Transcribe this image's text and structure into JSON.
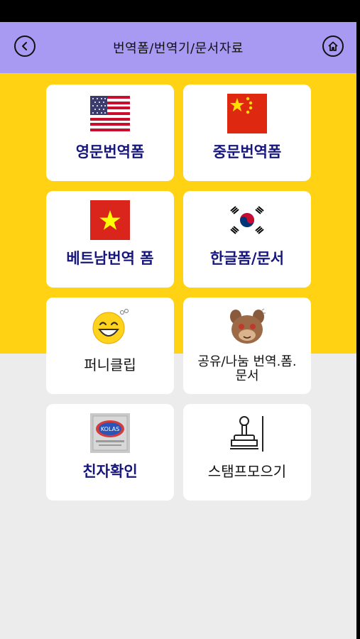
{
  "header": {
    "title": "번역폼/번역기/문서자료"
  },
  "tiles": [
    {
      "label": "영문번역폼",
      "icon": "us-flag-icon"
    },
    {
      "label": "중문번역폼",
      "icon": "china-flag-icon"
    },
    {
      "label": "베트남번역 폼",
      "icon": "vietnam-flag-icon"
    },
    {
      "label": "한글폼/문서",
      "icon": "korea-flag-icon"
    },
    {
      "label": "퍼니클립",
      "icon": "laughing-face-icon"
    },
    {
      "label": "공유/나눔 번역.폼.\n문서",
      "icon": "cartoon-bear-icon"
    },
    {
      "label": "친자확인",
      "icon": "kolas-badge-icon"
    },
    {
      "label": "스탬프모으기",
      "icon": "stamp-icon"
    }
  ],
  "colors": {
    "header": "#a89af2",
    "band": "#ffd314",
    "label": "#17177d",
    "background": "#ececec"
  }
}
